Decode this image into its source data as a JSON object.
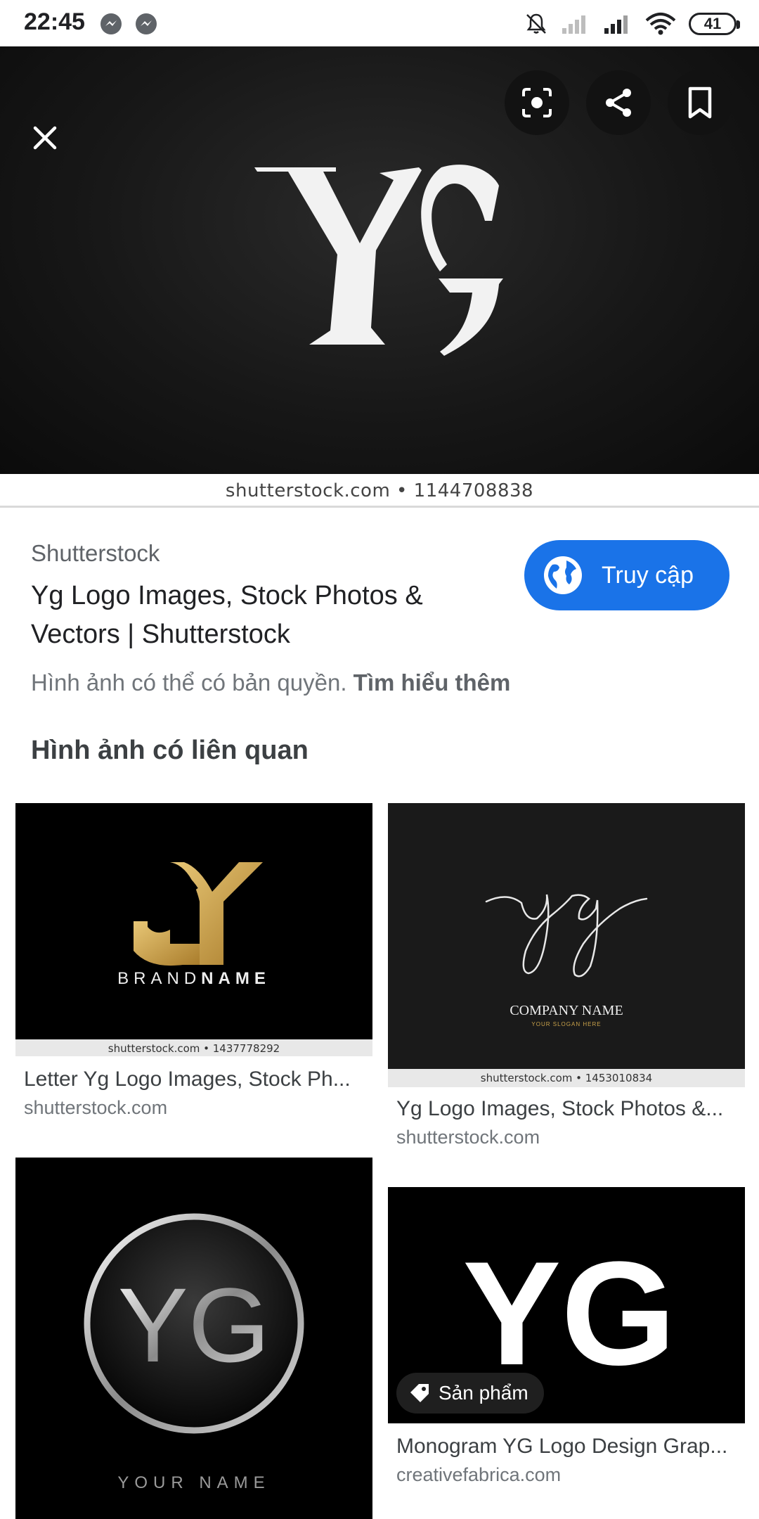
{
  "status_bar": {
    "time": "22:45",
    "battery": "41",
    "icons": [
      "messenger-icon",
      "messenger-icon",
      "mute-icon",
      "signal-icon",
      "signal-icon",
      "wifi-icon",
      "battery-icon"
    ]
  },
  "hero": {
    "watermark": "shutterstock.com • 1144708838",
    "logo_text": "Yg",
    "actions": [
      "close-icon",
      "lens-icon",
      "share-icon",
      "bookmark-icon"
    ]
  },
  "result": {
    "source": "Shutterstock",
    "title": "Yg Logo Images, Stock Photos & Vectors | Shutterstock",
    "visit_label": "Truy cập",
    "copyright_text": "Hình ảnh có thể có bản quyền.",
    "learn_more": "Tìm hiểu thêm"
  },
  "related": {
    "heading": "Hình ảnh có liên quan",
    "items": [
      {
        "title": "Letter Yg Logo Images, Stock Ph...",
        "source": "shutterstock.com",
        "watermark": "shutterstock.com • 1437778292",
        "img_text_a": "BRAND",
        "img_text_b": "NAME"
      },
      {
        "title": "Yg Logo Images, Stock Photos &...",
        "source": "shutterstock.com",
        "watermark": "shutterstock.com • 1453010834",
        "img_text_a": "COMPANY NAME",
        "img_text_b": "YOUR SLOGAN HERE"
      },
      {
        "title": "",
        "source": "",
        "img_text_a": "YG",
        "img_text_b": "YOUR NAME"
      },
      {
        "title": "Monogram YG Logo Design Grap...",
        "source": "creativefabrica.com",
        "img_text_a": "YG",
        "tag_label": "Sản phẩm"
      }
    ]
  },
  "colors": {
    "accent": "#1a73e8",
    "hero_bg": "#141414",
    "gold": "#c9a24a"
  }
}
